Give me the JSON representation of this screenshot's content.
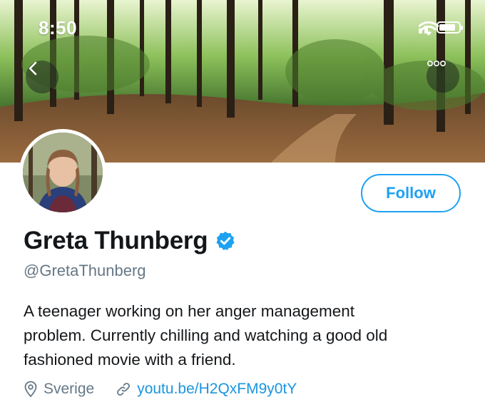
{
  "status_bar": {
    "time": "8:50",
    "signal_icon": "cellular-signal-icon",
    "wifi_icon": "wifi-icon",
    "battery_icon": "battery-icon"
  },
  "header": {
    "back_icon": "chevron-left-icon",
    "more_icon": "more-horizontal-icon",
    "banner": "forest-banner-image",
    "avatar": "profile-avatar-image"
  },
  "profile": {
    "display_name": "Greta Thunberg",
    "verified_icon": "verified-badge-icon",
    "handle": "@GretaThunberg",
    "follow_label": "Follow",
    "bio_lines": [
      "A teenager working on her anger management",
      "problem. Currently chilling and watching a good old",
      "fashioned movie with a friend."
    ],
    "location_icon": "location-pin-icon",
    "location": "Sverige",
    "link_icon": "link-icon",
    "link": "youtu.be/H2QxFM9y0tY"
  },
  "colors": {
    "accent": "#1da1f2",
    "link": "#1b95e0",
    "secondary_text": "#657786",
    "primary_text": "#14171a"
  }
}
